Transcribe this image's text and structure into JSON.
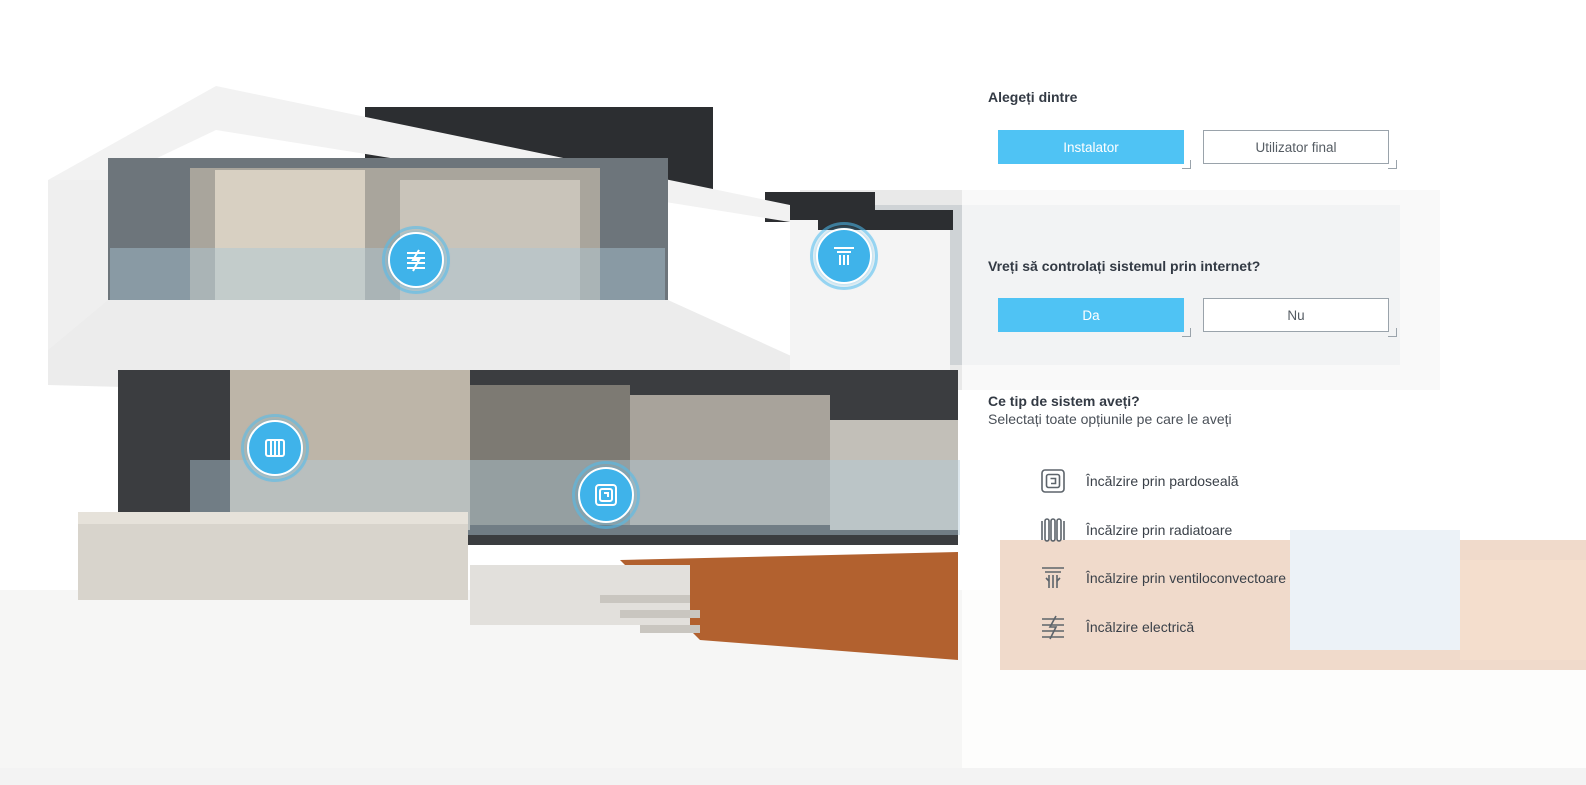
{
  "question1": {
    "title": "Alegeți dintre",
    "options": [
      {
        "label": "Instalator",
        "selected": true
      },
      {
        "label": "Utilizator final",
        "selected": false
      }
    ]
  },
  "question2": {
    "title": "Vreți să controlați sistemul prin internet?",
    "options": [
      {
        "label": "Da",
        "selected": true
      },
      {
        "label": "Nu",
        "selected": false
      }
    ]
  },
  "question3": {
    "title": "Ce tip de sistem aveți?",
    "subtitle": "Selectați toate opțiunile pe care le aveți",
    "options": [
      {
        "label": "Încălzire prin pardoseală",
        "icon": "floor-heating-icon"
      },
      {
        "label": "Încălzire prin radiatoare",
        "icon": "radiator-icon"
      },
      {
        "label": "Încălzire prin ventiloconvectoare",
        "icon": "fan-coil-icon"
      },
      {
        "label": "Încălzire electrică",
        "icon": "electric-heating-icon"
      }
    ]
  },
  "hotspots": [
    {
      "icon": "electric-heating-icon"
    },
    {
      "icon": "fan-coil-icon"
    },
    {
      "icon": "radiator-icon"
    },
    {
      "icon": "floor-heating-icon"
    }
  ],
  "colors": {
    "accent": "#4fc3f4",
    "hotspot": "#3fb3ea",
    "text": "#333a44"
  }
}
